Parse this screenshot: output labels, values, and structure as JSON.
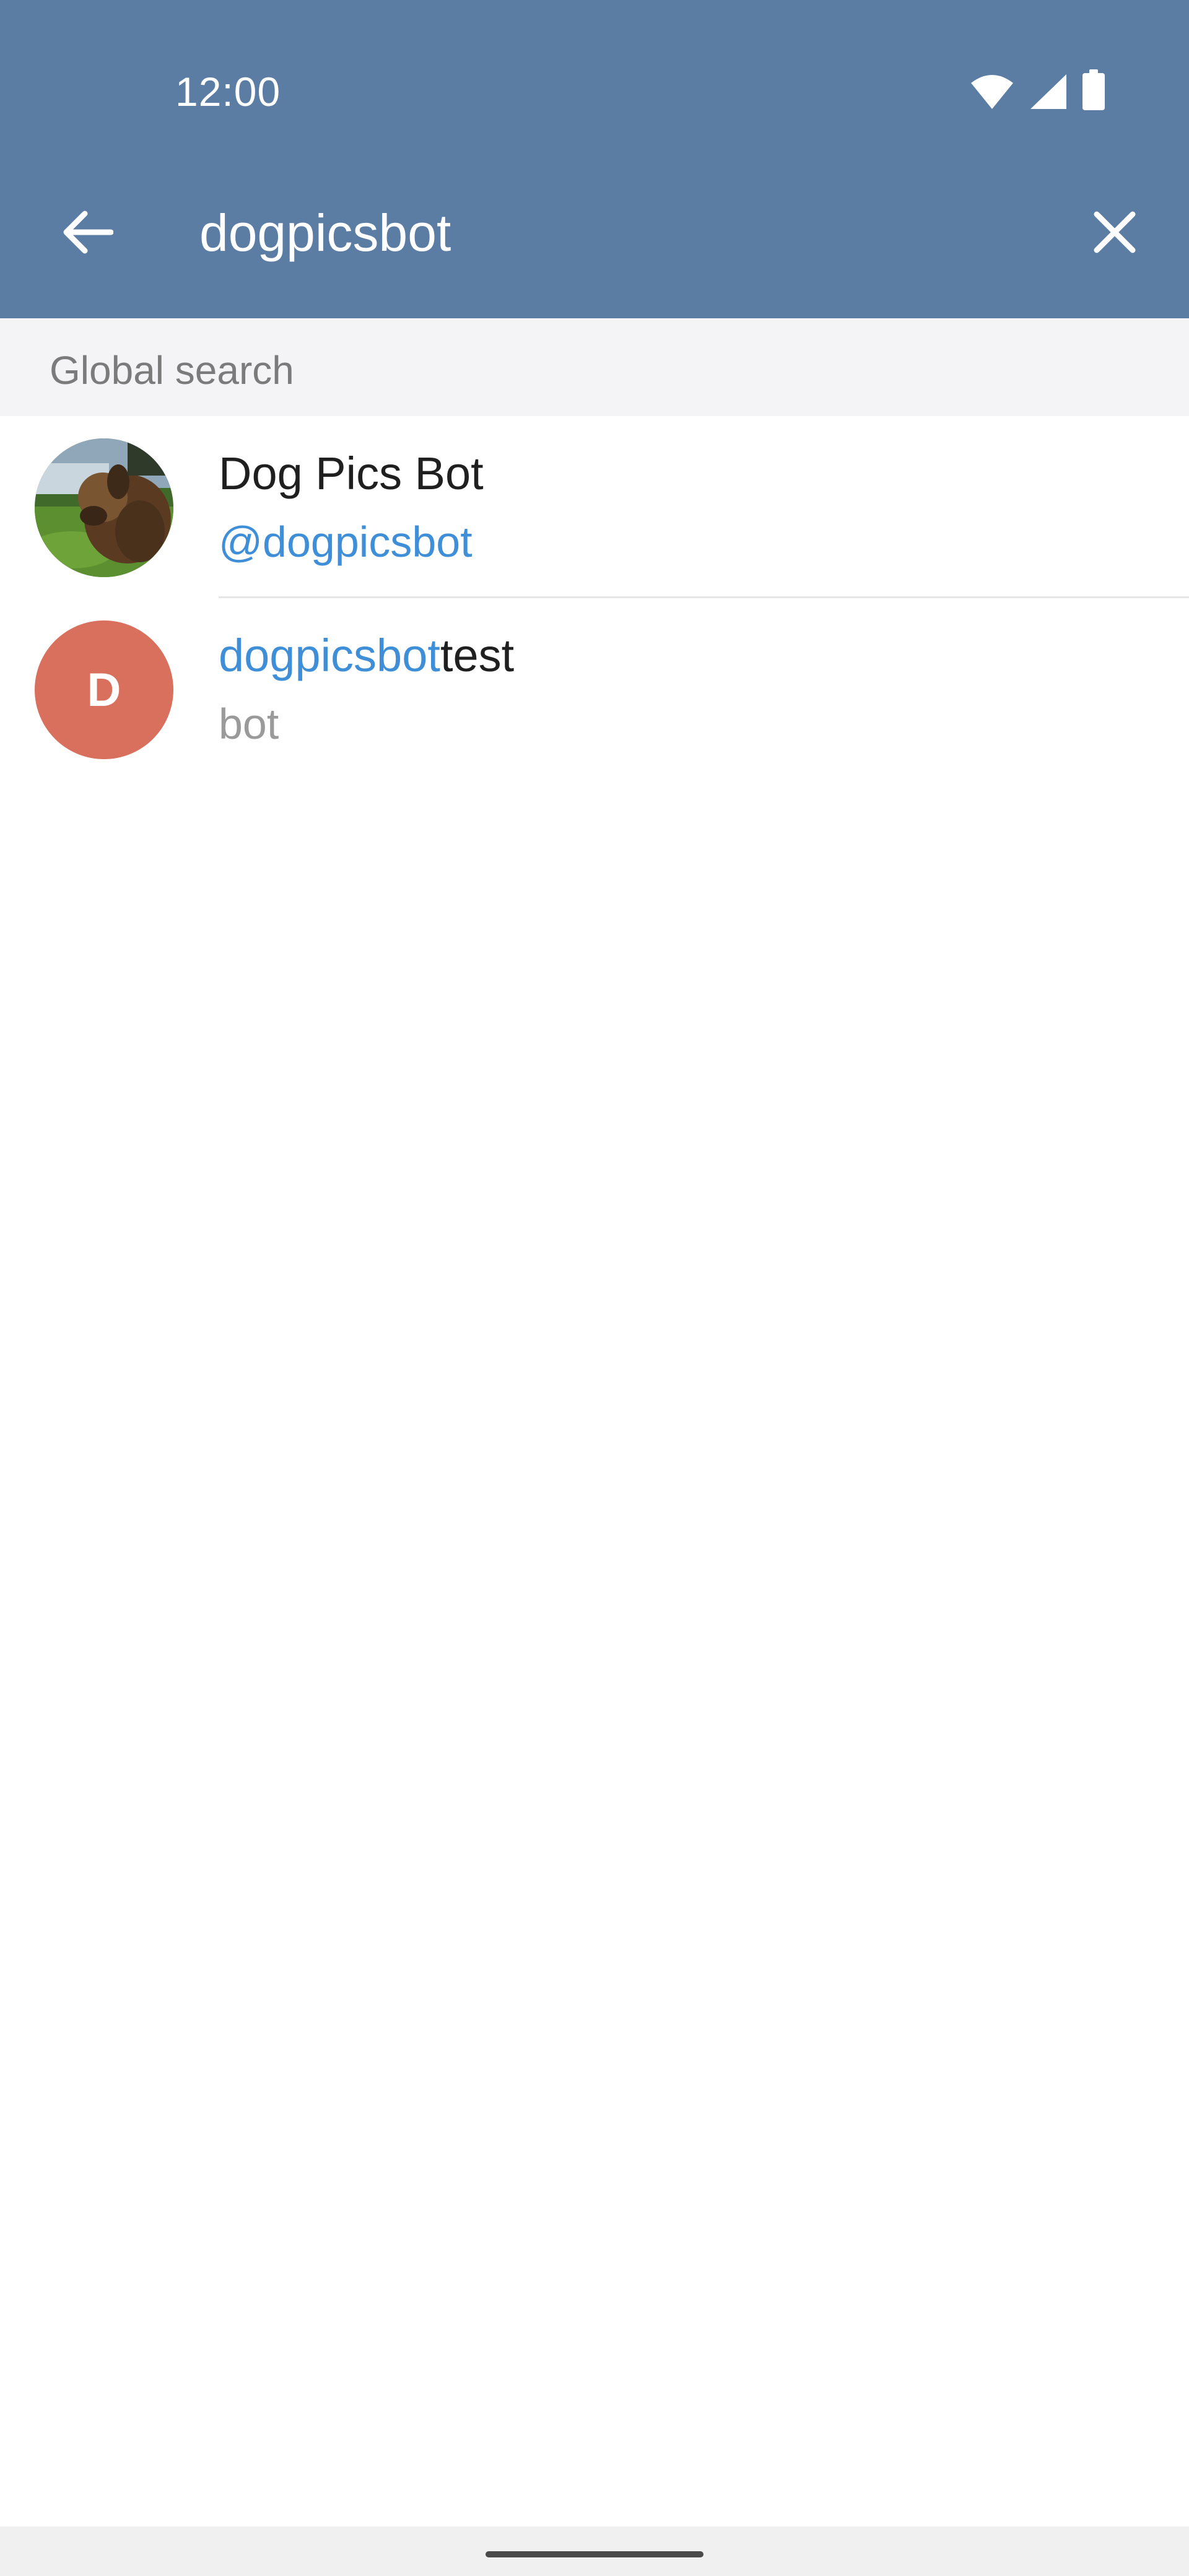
{
  "status_bar": {
    "time": "12:00",
    "icons": [
      "wifi-icon",
      "signal-icon",
      "battery-icon"
    ]
  },
  "search_bar": {
    "back_icon": "arrow-left-icon",
    "query": "dogpicsbot",
    "clear_icon": "close-icon"
  },
  "section": {
    "label": "Global search"
  },
  "results": [
    {
      "title": "Dog Pics Bot",
      "subtitle": "@dogpicsbot",
      "avatar": "dog-photo"
    },
    {
      "title_highlight": "dogpicsbot",
      "title_rest": "test",
      "subtitle": "bot",
      "avatar_letter": "D"
    }
  ],
  "colors": {
    "header": "#5b7da4",
    "accent": "#3f8fd8",
    "avatar_letter_bg": "#d9705e",
    "section_bg": "#f4f4f6"
  }
}
